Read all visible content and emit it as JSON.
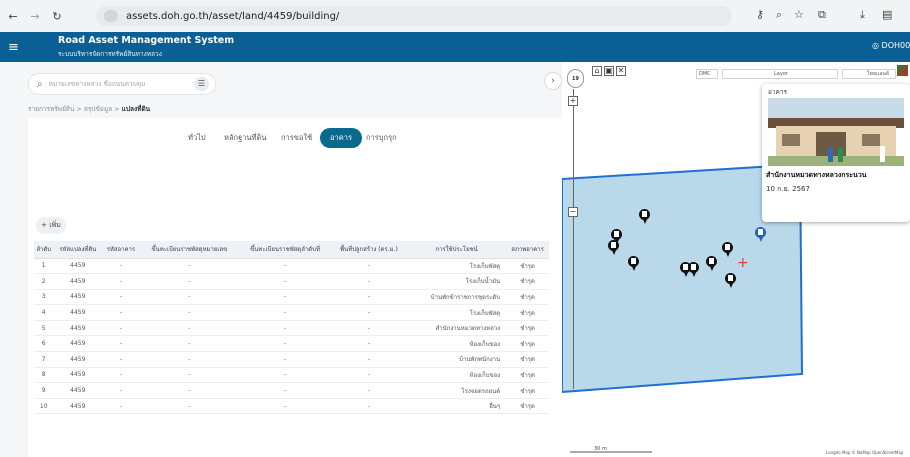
{
  "browser": {
    "url": "assets.doh.go.th/asset/land/4459/building/"
  },
  "app": {
    "title": "Road Asset Management System",
    "subtitle": "ระบบบริหารจัดการทรัพย์สินทางหลวง",
    "user": "DOH00"
  },
  "search": {
    "placeholder": "หมายเลขทางหลวง ชื่อถนนควบคุม"
  },
  "breadcrumb": {
    "items": [
      "รายการทรัพย์สิน",
      "สรุปข้อมูล"
    ],
    "current": "แปลงที่ดิน"
  },
  "tabs": [
    "ทั่วไป",
    "หลักฐานที่ดิน",
    "การขอใช้",
    "อาคาร",
    "การบุกรุก"
  ],
  "active_tab": "อาคาร",
  "add_label": "+ เพิ่ม",
  "table": {
    "headers": [
      "ลำดับ",
      "รหัสแปลงที่ดิน",
      "รหัสอาคาร",
      "ขึ้นทะเบียนราชพัสดุหมายเลข",
      "ขึ้นทะเบียนราชพัสดุลำดับที่",
      "พื้นที่ปลูกสร้าง (ตร.ม.)",
      "การใช้ประโยชน์",
      "สภาพอาคาร"
    ],
    "rows": [
      [
        "1",
        "4459",
        "-",
        "-",
        "-",
        "-",
        "โรงเก็บพัสดุ",
        "ชำรุด"
      ],
      [
        "2",
        "4459",
        "-",
        "-",
        "-",
        "-",
        "โรงเก็บน้ำมัน",
        "ชำรุด"
      ],
      [
        "3",
        "4459",
        "-",
        "-",
        "-",
        "-",
        "บ้านพักข้าราชการชุดระดับ",
        "ชำรุด"
      ],
      [
        "4",
        "4459",
        "-",
        "-",
        "-",
        "-",
        "โรงเก็บพัสดุ",
        "ชำรุด"
      ],
      [
        "5",
        "4459",
        "-",
        "-",
        "-",
        "-",
        "สำนักงานหมวดทางหลวง",
        "ชำรุด"
      ],
      [
        "6",
        "4459",
        "-",
        "-",
        "-",
        "-",
        "ห้องเก็บของ",
        "ชำรุด"
      ],
      [
        "7",
        "4459",
        "-",
        "-",
        "-",
        "-",
        "บ้านพักพนักงาน",
        "ชำรุด"
      ],
      [
        "8",
        "4459",
        "-",
        "-",
        "-",
        "-",
        "ห้องเก็บของ",
        "ชำรุด"
      ],
      [
        "9",
        "4459",
        "-",
        "-",
        "-",
        "-",
        "โรงจอดรถยนต์",
        "ชำรุด"
      ],
      [
        "10",
        "4459",
        "-",
        "-",
        "-",
        "-",
        "อื่นๆ",
        "ชำรุด"
      ]
    ]
  },
  "map": {
    "zoom": "19",
    "dms_label": "DMC",
    "layer_label": "Layer",
    "basemap_label": "ไทยแลนด์",
    "scale_label": "30 m",
    "attribution": "Longdo Map © NoMap OpenStreetMap",
    "parcel_color": "#b9d9ea",
    "parcel_border": "#1f6fd4"
  },
  "popup": {
    "label": "อาคาร",
    "name": "สำนักงานหมวดทางหลวงกระนวน",
    "date": "10 ก.ย. 2567"
  }
}
